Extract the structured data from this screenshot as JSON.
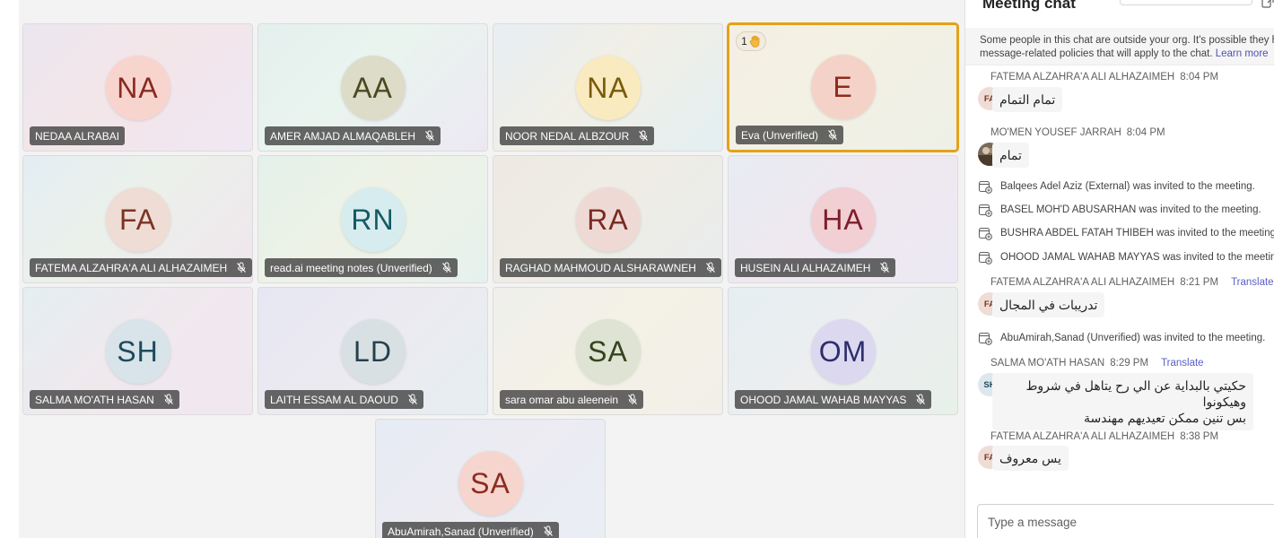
{
  "stage": {
    "participants": [
      {
        "initials": "NA",
        "name": "NEDAA ALRABAI",
        "muted": false,
        "avatar_bg": "#f8d4cf",
        "avatar_fg": "#8a2a1e",
        "tile_bg": "linear-gradient(135deg,#ece6ef,#f3e6e9 45%,#efe7f3)"
      },
      {
        "initials": "AA",
        "name": "AMER AMJAD ALMAQABLEH",
        "muted": true,
        "avatar_bg": "#dcdcc9",
        "avatar_fg": "#4a4a1e",
        "tile_bg": "linear-gradient(135deg,#e4f0ee,#eaf4ef 45%,#ece8f3)"
      },
      {
        "initials": "NA",
        "name": "NOOR NEDAL ALBZOUR",
        "muted": true,
        "avatar_bg": "#f9eabf",
        "avatar_fg": "#7a5a0a",
        "tile_bg": "linear-gradient(135deg,#e7eef3,#f1efe6 45%,#e3eff2)"
      },
      {
        "initials": "E",
        "name": "Eva (Unverified)",
        "muted": true,
        "active": true,
        "hand_count": "1",
        "avatar_bg": "#f5d2c8",
        "avatar_fg": "#8e2b1c",
        "tile_bg": "linear-gradient(135deg,#f4efe4,#f3f0e4 45%,#eef0e7)"
      },
      {
        "initials": "FA",
        "name": "FATEMA ALZAHRA'A ALI ALHAZAIMEH",
        "muted": true,
        "avatar_bg": "#efdcd5",
        "avatar_fg": "#7a3424",
        "tile_bg": "linear-gradient(135deg,#e3eef3,#ecf0ea 45%,#efe6ee)"
      },
      {
        "initials": "RN",
        "name": "read.ai meeting notes (Unverified)",
        "muted": true,
        "avatar_bg": "#d7ecee",
        "avatar_fg": "#155a66",
        "tile_bg": "linear-gradient(135deg,#e4f1ea,#eef2e6 45%,#e6f1ee)"
      },
      {
        "initials": "RA",
        "name": "RAGHAD MAHMOUD ALSHARAWNEH",
        "muted": true,
        "avatar_bg": "#eed9d5",
        "avatar_fg": "#7a2a22",
        "tile_bg": "linear-gradient(135deg,#eeeae3,#eeece4 45%,#e9ecee)"
      },
      {
        "initials": "HA",
        "name": "HUSEIN ALI ALHAZAIMEH",
        "muted": true,
        "avatar_bg": "#f1cfd3",
        "avatar_fg": "#7e1e2c",
        "tile_bg": "linear-gradient(135deg,#e8ecf3,#efe8ef 45%,#ece9f4)"
      },
      {
        "initials": "SH",
        "name": "SALMA MO'ATH HASAN",
        "muted": true,
        "avatar_bg": "#d8e4ea",
        "avatar_fg": "#1d4a5c",
        "tile_bg": "linear-gradient(135deg,#e4eef1,#efe9ee 45%,#f1e7ee)"
      },
      {
        "initials": "LD",
        "name": "LAITH ESSAM AL DAOUD",
        "muted": true,
        "avatar_bg": "#d9e0e4",
        "avatar_fg": "#26404c",
        "tile_bg": "linear-gradient(135deg,#e6e7f3,#eceaf1 45%,#e6eef1)"
      },
      {
        "initials": "SA",
        "name": "sara omar abu aleenein",
        "muted": true,
        "avatar_bg": "#dfe3d3",
        "avatar_fg": "#34441d",
        "tile_bg": "linear-gradient(135deg,#efefec,#f4f1e6 45%,#f1efe8)"
      },
      {
        "initials": "OM",
        "name": "OHOOD JAMAL WAHAB MAYYAS",
        "muted": true,
        "avatar_bg": "#dcd8ef",
        "avatar_fg": "#2d2e6e",
        "tile_bg": "linear-gradient(135deg,#e5eef1,#eceef0 45%,#e8f0ea)"
      },
      {
        "initials": "SA",
        "name": "AbuAmirah,Sanad (Unverified)",
        "muted": true,
        "avatar_bg": "#f6d5ce",
        "avatar_fg": "#8a2d20",
        "tile_bg": "linear-gradient(135deg,#e6ebf4,#ecebf2 45%,#e9eef4)"
      }
    ]
  },
  "chat": {
    "title": "Meeting chat",
    "notice_line1": "Some people in this chat are outside your org. It's possible they have",
    "notice_line2": "message-related policies that will apply to the chat.",
    "learn_more": "Learn more",
    "translate_label": "Translate",
    "events": [
      {
        "type": "message",
        "author": "FATEMA ALZAHRA'A ALI ALHAZAIMEH",
        "time": "8:04 PM",
        "text": "تمام التمام",
        "avatar": "FA",
        "presence": "busy"
      },
      {
        "type": "message",
        "author": "MO'MEN YOUSEF JARRAH",
        "time": "8:04 PM",
        "text": "تمام",
        "avatar": "photo",
        "presence": "available"
      },
      {
        "type": "system",
        "text": "Balqees Adel Aziz (External) was invited to the meeting."
      },
      {
        "type": "system",
        "text": "BASEL MOH'D ABUSARHAN was invited to the meeting."
      },
      {
        "type": "system",
        "text": "BUSHRA ABDEL FATAH THIBEH was invited to the meeting."
      },
      {
        "type": "system",
        "text": "OHOOD JAMAL WAHAB MAYYAS was invited to the meeting."
      },
      {
        "type": "message",
        "author": "FATEMA ALZAHRA'A ALI ALHAZAIMEH",
        "time": "8:21 PM",
        "translate": true,
        "text": "تدريبات في المجال",
        "avatar": "FA",
        "presence": "busy"
      },
      {
        "type": "system",
        "text": "AbuAmirah,Sanad (Unverified) was invited to the meeting."
      },
      {
        "type": "message",
        "author": "SALMA MO'ATH HASAN",
        "time": "8:29 PM",
        "translate": true,
        "text_line1": "حكيتي بالبداية عن الي رح يتاهل في شروط وهيكونوا",
        "text_line2": "بس تنين  ممكن تعيديهم مهندسة",
        "avatar": "SH",
        "presence": "busy"
      },
      {
        "type": "message",
        "author": "FATEMA ALZAHRA'A ALI ALHAZAIMEH",
        "time": "8:38 PM",
        "text": "يس معروف",
        "avatar": "FA",
        "presence": "busy"
      }
    ],
    "composer_placeholder": "Type a message"
  },
  "colors": {
    "accent": "#5b5fc7",
    "active_speaker": "#e3a21a",
    "busy": "#d13438",
    "available": "#13a10e"
  }
}
